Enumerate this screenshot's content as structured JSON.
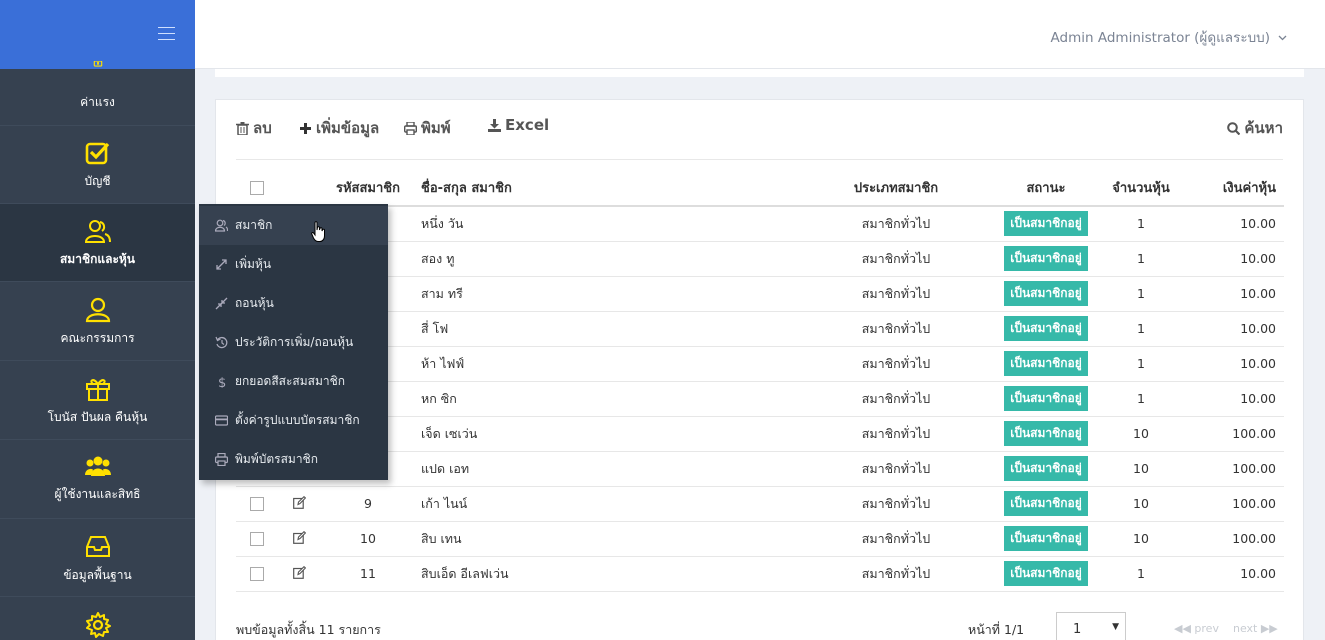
{
  "sidebar": {
    "items": [
      {
        "label": "ค่าแรง",
        "icon": "wage-icon"
      },
      {
        "label": "บัญชี",
        "icon": "check-square-icon"
      },
      {
        "label": "สมาชิกและหุ้น",
        "icon": "users-icon"
      },
      {
        "label": "คณะกรรมการ",
        "icon": "user-icon"
      },
      {
        "label": "โบนัส ปันผล คืนหุ้น",
        "icon": "gift-icon"
      },
      {
        "label": "ผู้ใช้งานและสิทธิ",
        "icon": "group-icon"
      },
      {
        "label": "ข้อมูลพื้นฐาน",
        "icon": "inbox-icon"
      },
      {
        "label": "",
        "icon": "gear-icon"
      }
    ]
  },
  "header": {
    "user": "Admin Administrator (ผู้ดูแลระบบ)"
  },
  "submenu": {
    "items": [
      {
        "label": "สมาชิก"
      },
      {
        "label": "เพิ่มหุ้น"
      },
      {
        "label": "ถอนหุ้น"
      },
      {
        "label": "ประวัติการเพิ่ม/ถอนหุ้น"
      },
      {
        "label": "ยกยอดสีสะสมสมาชิก"
      },
      {
        "label": "ตั้งค่ารูปแบบบัตรสมาชิก"
      },
      {
        "label": "พิมพ์บัตรสมาชิก"
      }
    ]
  },
  "toolbar": {
    "delete": "ลบ",
    "add": "เพิ่มข้อมูล",
    "print": "พิมพ์",
    "excel": "Excel",
    "search": "ค้นหา"
  },
  "table": {
    "headers": [
      "รหัสสมาชิก",
      "ชื่อ-สกุล สมาชิก",
      "ประเภทสมาชิก",
      "สถานะ",
      "จำนวนหุ้น",
      "เงินค่าหุ้น"
    ],
    "rows": [
      {
        "id": "",
        "name": "หนึ่ง วัน",
        "type": "สมาชิกทั่วไป",
        "status": "เป็นสมาชิกอยู่",
        "shares": "1",
        "amount": "10.00"
      },
      {
        "id": "",
        "name": "สอง ทู",
        "type": "สมาชิกทั่วไป",
        "status": "เป็นสมาชิกอยู่",
        "shares": "1",
        "amount": "10.00"
      },
      {
        "id": "",
        "name": "สาม ทรี",
        "type": "สมาชิกทั่วไป",
        "status": "เป็นสมาชิกอยู่",
        "shares": "1",
        "amount": "10.00"
      },
      {
        "id": "",
        "name": "สี่ โฟ",
        "type": "สมาชิกทั่วไป",
        "status": "เป็นสมาชิกอยู่",
        "shares": "1",
        "amount": "10.00"
      },
      {
        "id": "",
        "name": "ห้า ไฟฟ์",
        "type": "สมาชิกทั่วไป",
        "status": "เป็นสมาชิกอยู่",
        "shares": "1",
        "amount": "10.00"
      },
      {
        "id": "",
        "name": "หก ซิก",
        "type": "สมาชิกทั่วไป",
        "status": "เป็นสมาชิกอยู่",
        "shares": "1",
        "amount": "10.00"
      },
      {
        "id": "",
        "name": "เจ็ด เซเว่น",
        "type": "สมาชิกทั่วไป",
        "status": "เป็นสมาชิกอยู่",
        "shares": "10",
        "amount": "100.00"
      },
      {
        "id": "",
        "name": "แปด เอท",
        "type": "สมาชิกทั่วไป",
        "status": "เป็นสมาชิกอยู่",
        "shares": "10",
        "amount": "100.00"
      },
      {
        "id": "9",
        "name": "เก้า ไนน์",
        "type": "สมาชิกทั่วไป",
        "status": "เป็นสมาชิกอยู่",
        "shares": "10",
        "amount": "100.00"
      },
      {
        "id": "10",
        "name": "สิบ เทน",
        "type": "สมาชิกทั่วไป",
        "status": "เป็นสมาชิกอยู่",
        "shares": "10",
        "amount": "100.00"
      },
      {
        "id": "11",
        "name": "สิบเอ็ด อีเลฟเว่น",
        "type": "สมาชิกทั่วไป",
        "status": "เป็นสมาชิกอยู่",
        "shares": "1",
        "amount": "10.00"
      }
    ]
  },
  "footer": {
    "total": "พบข้อมูลทั้งสิ้น 11 รายการ",
    "page_info": "หน้าที่ 1/1",
    "page_select": "1",
    "prev": "◀◀ prev",
    "next": "next ▶▶"
  },
  "colors": {
    "brand": "#3a6fd8",
    "sidebar": "#364150",
    "icon": "#ffe000",
    "badge": "#36b9a9"
  }
}
